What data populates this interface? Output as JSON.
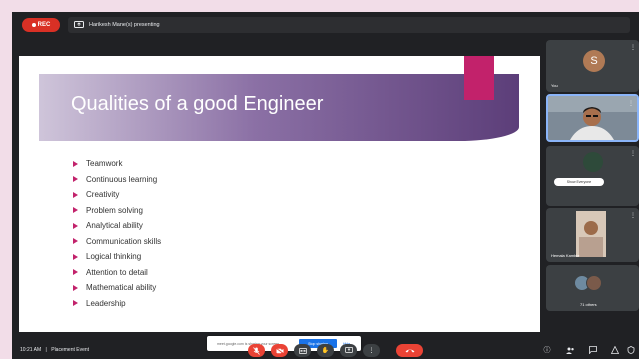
{
  "topbar": {
    "rec_label": "REC",
    "presenting_text": "Harikesh Mane(s) presenting"
  },
  "slide": {
    "title": "Qualities of a good Engineer",
    "bullets": [
      "Teamwork",
      "Continuous learning",
      "Creativity",
      "Problem solving",
      "Analytical ability",
      "Communication skills",
      "Logical thinking",
      "Attention to detail",
      "Mathematical ability",
      "Leadership"
    ],
    "share_banner": {
      "text": "meet.google.com is sharing your screen",
      "stop_label": "Stop sharing",
      "hide_label": "Hide"
    }
  },
  "tiles": [
    {
      "name": "You",
      "avatar_letter": "S",
      "avatar_color": "#b07a55"
    },
    {
      "name": ""
    },
    {
      "name": "",
      "chip": "Show Everyone"
    },
    {
      "name": "Hemala Kamble"
    },
    {
      "name": "71 others"
    }
  ],
  "bottombar": {
    "time": "10:21 AM",
    "separator": "|",
    "meeting_name": "Placement Event"
  },
  "colors": {
    "accent": "#c2226b",
    "end_call": "#ea4335",
    "share_button": "#1a73e8"
  }
}
